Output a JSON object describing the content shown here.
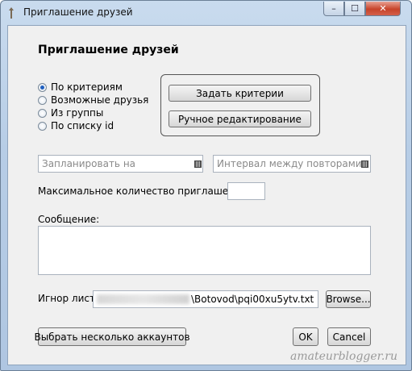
{
  "window": {
    "title": "Приглашение друзей",
    "controls": {
      "minimize": "–",
      "maximize": "☐",
      "close": "✕"
    }
  },
  "heading": "Приглашение друзей",
  "source_options": [
    {
      "label": "По критериям",
      "selected": true
    },
    {
      "label": "Возможные друзья",
      "selected": false
    },
    {
      "label": "Из группы",
      "selected": false
    },
    {
      "label": "По списку id",
      "selected": false
    }
  ],
  "criteria_buttons": {
    "set_criteria": "Задать критерии",
    "manual_edit": "Ручное редактирование"
  },
  "schedule": {
    "planned_placeholder": "Запланировать на",
    "interval_placeholder": "Интервал между повторами"
  },
  "max_invites": {
    "label": "Максимальное количество приглашений",
    "value": ""
  },
  "message": {
    "label": "Сообщение:",
    "value": ""
  },
  "ignore_list": {
    "label": "Игнор лист",
    "path_suffix": "\\Botovod\\pqi00xu5ytv.txt",
    "browse": "Browse..."
  },
  "footer": {
    "select_accounts": "Выбрать несколько аккаунтов",
    "ok": "OK",
    "cancel": "Cancel"
  },
  "watermark": "amateurblogger.ru",
  "colors": {
    "radio_dot": "#1f5fbf",
    "close_button": "#c7432a",
    "frame": "#b7cde6"
  }
}
